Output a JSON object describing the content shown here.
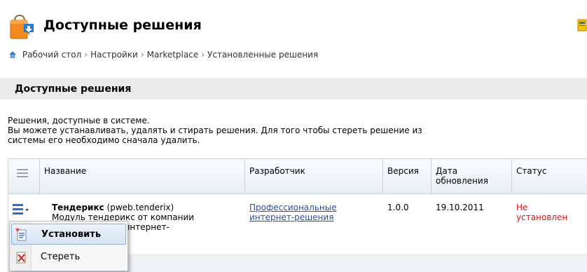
{
  "header": {
    "title": "Доступные решения"
  },
  "breadcrumb": [
    "Рабочий стол",
    "Настройки",
    "Marketplace",
    "Установленные решения"
  ],
  "section": {
    "title": "Доступные решения"
  },
  "description": {
    "line1": "Решения, доступные в системе.",
    "line2": "Вы можете устанавливать, удалять и стирать решения. Для того чтобы стереть решение из",
    "line3": "системы его необходимо сначала удалить."
  },
  "table": {
    "headers": {
      "name": "Название",
      "developer": "Разработчик",
      "version": "Версия",
      "date_line1": "Дата",
      "date_line2": "обновления",
      "status": "Статус"
    },
    "row": {
      "name": "Тендерикс",
      "code": "(pweb.tenderix)",
      "desc_line1": "Модуль тендерикс от компании",
      "desc_line2": "ьные интернет-",
      "developer_line1": "Профессиональные",
      "developer_line2": "интернет-решения",
      "version": "1.0.0",
      "date": "19.10.2011",
      "status_line1": "Не",
      "status_line2": "установлен"
    }
  },
  "context_menu": {
    "install_label": "Установить",
    "erase_label": "Стереть"
  },
  "colors": {
    "status": "#dd1111",
    "link": "#2a4fa8",
    "section_bar": "#ebebeb"
  }
}
